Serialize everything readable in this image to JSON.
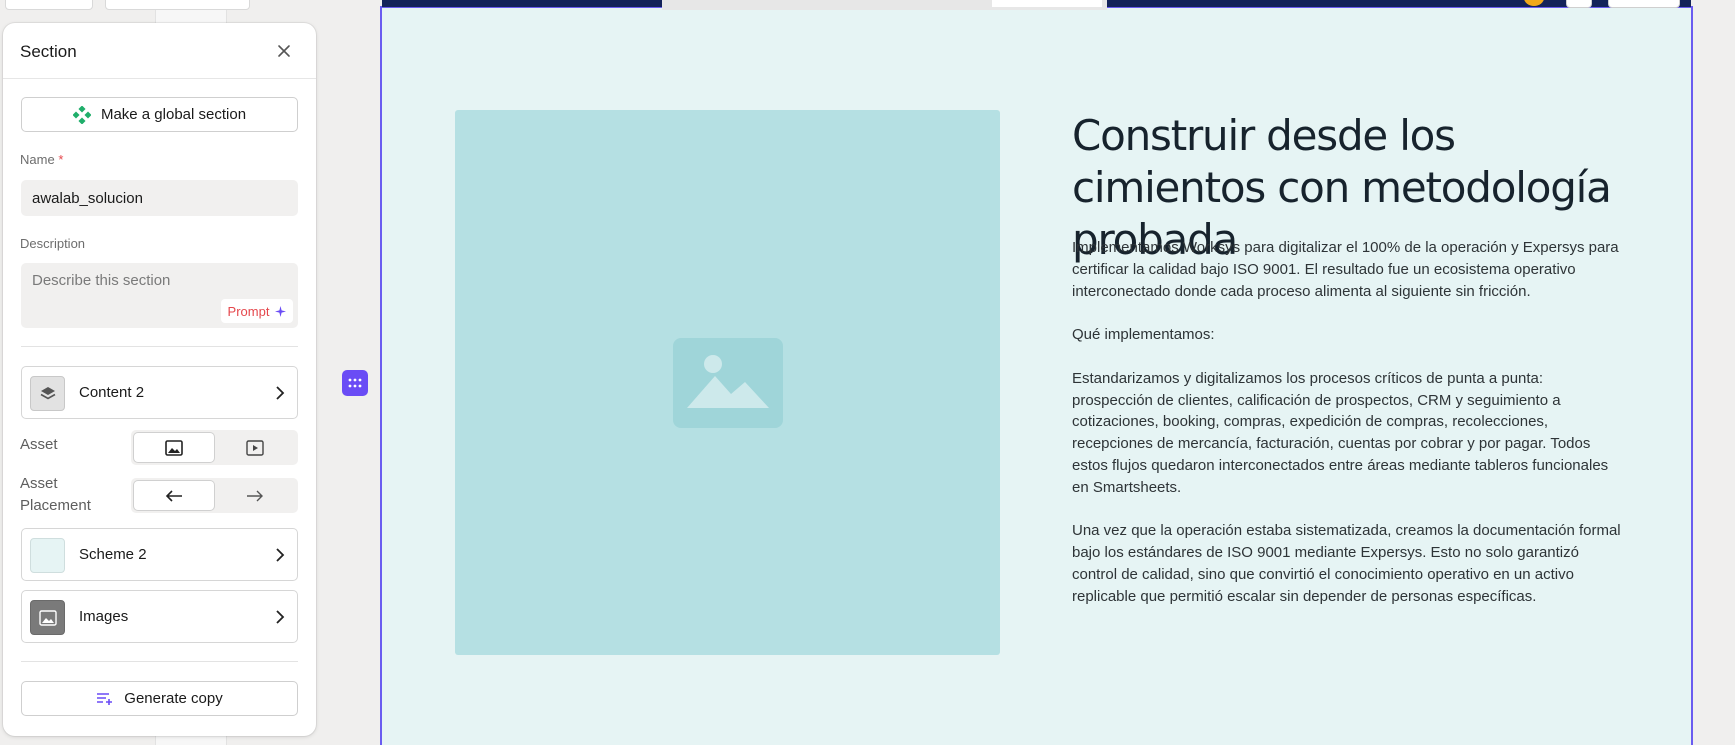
{
  "panel": {
    "title": "Section",
    "global_section_label": "Make a global section",
    "name_label": "Name",
    "name_required_mark": "*",
    "name_value": "awalab_solucion",
    "description_label": "Description",
    "description_placeholder": "Describe this section",
    "prompt_label": "Prompt",
    "content_label": "Content 2",
    "asset_label": "Asset",
    "asset_placement_label": "Asset Placement",
    "scheme_label": "Scheme 2",
    "images_label": "Images",
    "generate_copy_label": "Generate copy"
  },
  "section": {
    "heading": "Construir desde los cimientos con metodología probada",
    "paragraphs": [
      "Implementamos Worksys para digitalizar el 100% de la operación y Expersys para certificar la calidad bajo ISO 9001. El resultado fue un ecosistema operativo interconectado donde cada proceso alimenta al siguiente sin fricción.",
      "Qué implementamos:",
      "Estandarizamos y digitalizamos los procesos críticos de punta a punta: prospección de clientes, calificación de prospectos, CRM y seguimiento a cotizaciones, booking, compras, expedición de compras, recolecciones, recepciones de mercancía, facturación, cuentas por cobrar y por pagar. Todos estos flujos quedaron interconectados entre áreas mediante tableros funcionales en Smartsheets.",
      "Una vez que la operación estaba sistematizada, creamos la documentación formal bajo los estándares de ISO 9001 mediante Expersys. Esto no solo garantizó control de calidad, sino que convirtió el conocimiento operativo en un activo replicable que permitió escalar sin depender de personas específicas."
    ]
  },
  "colors": {
    "canvas_bg": "#e6f4f4",
    "image_placeholder": "#b5e0e3",
    "selection_outline": "#6a5cf0",
    "accent_purple": "#6a4cf5",
    "global_section_green": "#1fae6a",
    "required_red": "#e5484d"
  },
  "icons": {
    "close": "close-icon",
    "global_section": "component-diamond-icon",
    "prompt": "sparkle-icon",
    "content": "layers-icon",
    "asset_image": "image-icon",
    "asset_video": "video-play-icon",
    "placement_left": "arrow-left-icon",
    "placement_right": "arrow-right-icon",
    "images": "image-icon",
    "generate_copy": "text-lines-plus-icon",
    "drag_handle": "grip-dots-icon"
  },
  "state": {
    "asset_selected": "image",
    "placement_selected": "left"
  }
}
